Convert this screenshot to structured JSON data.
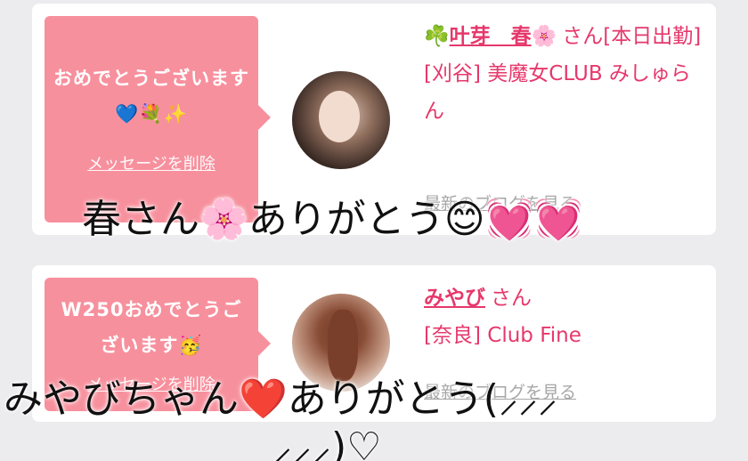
{
  "cards": [
    {
      "message": "おめでとうございます💙💐✨",
      "delete_label": "メッセージを削除",
      "name_prefix": "☘️",
      "name": "叶芽　春",
      "name_suffix": "🌸",
      "honorific": "さん[本日出勤]",
      "shop": "[刈谷] 美魔女CLUB みしゅらん",
      "blog_label": "最新のブログを見る"
    },
    {
      "message": "W250おめでとうございます🥳",
      "delete_label": "メッセージを削除",
      "name": "みやび",
      "honorific": "さん",
      "shop": "[奈良] Club Fine",
      "blog_label": "最新のブログを見る"
    }
  ],
  "overlays": {
    "line1": "春さん🌸ありがとう😊💓💓",
    "line2": "みやびちゃん❤️ありがとう(⸝⸝⸝",
    "line3": "⸝⸝⸝)♡"
  }
}
